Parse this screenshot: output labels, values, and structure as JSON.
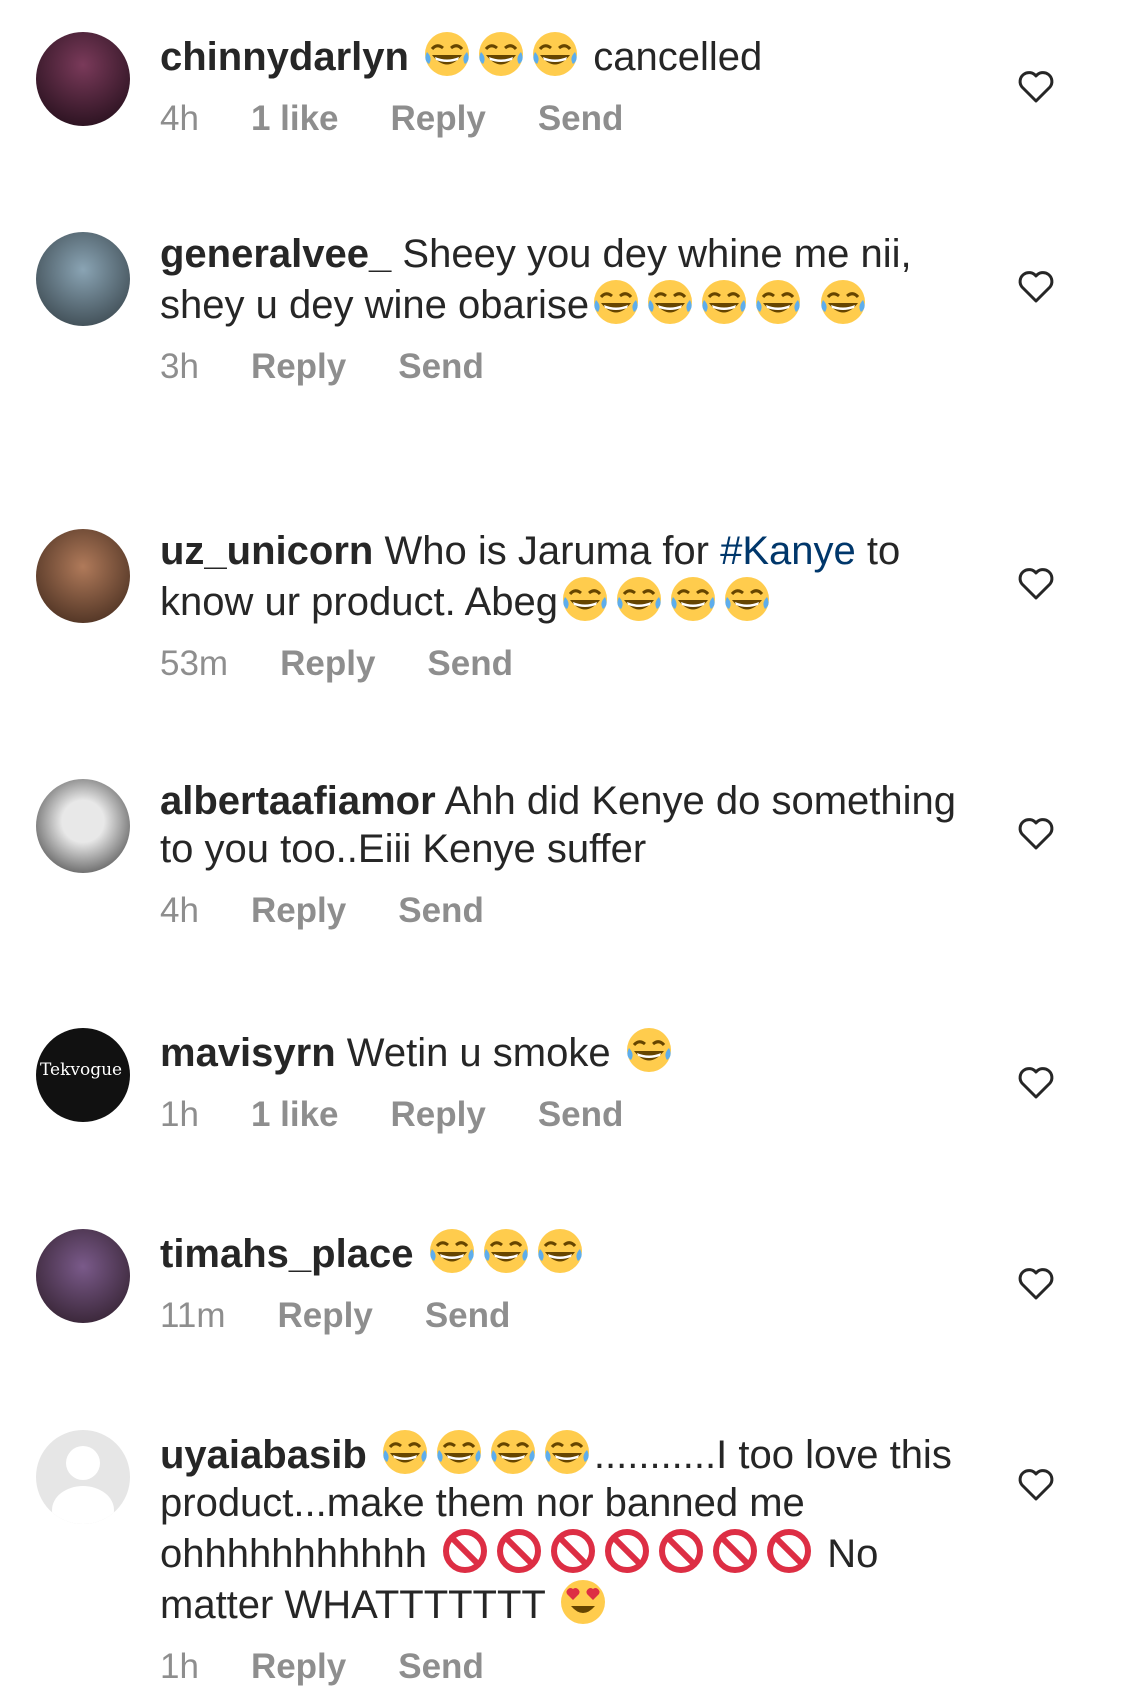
{
  "colors": {
    "username": "#262626",
    "meta": "#8e8e8e",
    "hashtag": "#00376b",
    "heart": "#262626"
  },
  "icons": {
    "laugh": "face-with-tears-of-joy-icon",
    "prohibited": "prohibited-icon",
    "heart_eyes": "smiling-face-with-heart-eyes-icon",
    "like": "heart-outline-icon"
  },
  "comments": [
    {
      "username": "chinnydarlyn",
      "text_after": "cancelled",
      "time": "4h",
      "likes": "1 like",
      "reply": "Reply",
      "send": "Send"
    },
    {
      "username": "generalvee_",
      "text": "Sheey you dey whine me nii, shey u dey wine obarise",
      "time": "3h",
      "reply": "Reply",
      "send": "Send"
    },
    {
      "username": "uz_unicorn",
      "text_a": "Who is Jaruma for",
      "hashtag": "#Kanye",
      "text_b": "to know ur product. Abeg",
      "time": "53m",
      "reply": "Reply",
      "send": "Send"
    },
    {
      "username": "albertaafiamor",
      "text": "Ahh did Kenye do something to you too..Eiii Kenye suffer",
      "time": "4h",
      "reply": "Reply",
      "send": "Send"
    },
    {
      "username": "mavisyrn",
      "text": "Wetin u smoke",
      "time": "1h",
      "likes": "1 like",
      "reply": "Reply",
      "send": "Send",
      "avatar_label": "Tekvogue"
    },
    {
      "username": "timahs_place",
      "time": "11m",
      "reply": "Reply",
      "send": "Send"
    },
    {
      "username": "uyaiabasib",
      "text_a": "...........I too love this product...make them nor banned me ohhhhhhhhhhh",
      "text_b": "No matter WHATTTTTTT",
      "time": "1h",
      "reply": "Reply",
      "send": "Send"
    }
  ]
}
